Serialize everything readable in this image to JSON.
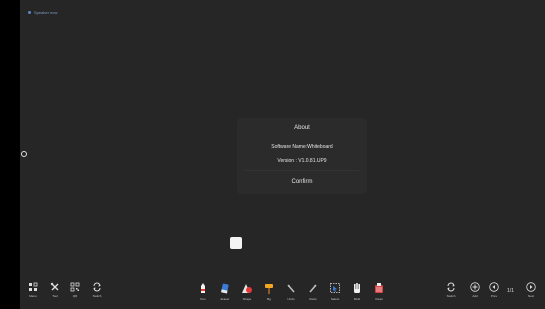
{
  "status": {
    "label": "Speaker now"
  },
  "dialog": {
    "title": "About",
    "software_name": "Software Name:Whiteboard",
    "version": "Version : V1.0.81.UP9",
    "confirm": "Confirm"
  },
  "toolbar": {
    "left": [
      {
        "label": "Menu",
        "icon": "menu-icon"
      },
      {
        "label": "Tool",
        "icon": "tools-icon"
      },
      {
        "label": "QR",
        "icon": "qr-code-icon"
      },
      {
        "label": "Switch",
        "icon": "switch-icon"
      }
    ],
    "center": [
      {
        "label": "Pen",
        "icon": "pen-icon"
      },
      {
        "label": "Eraser",
        "icon": "eraser-icon"
      },
      {
        "label": "Shape",
        "icon": "shape-icon"
      },
      {
        "label": "Bg",
        "icon": "paint-bucket-icon"
      },
      {
        "label": "Undo",
        "icon": "undo-icon"
      },
      {
        "label": "Redo",
        "icon": "redo-icon"
      },
      {
        "label": "Select",
        "icon": "select-icon"
      },
      {
        "label": "Multi",
        "icon": "multi-touch-icon"
      },
      {
        "label": "Clean",
        "icon": "clean-icon"
      }
    ],
    "right": [
      {
        "label": "Switch",
        "icon": "switch-icon"
      },
      {
        "label": "Add",
        "icon": "add-page-icon"
      },
      {
        "label": "Prev",
        "icon": "prev-page-icon"
      },
      {
        "label": "Next",
        "icon": "next-page-icon"
      }
    ],
    "page_indicator": "1/1"
  }
}
